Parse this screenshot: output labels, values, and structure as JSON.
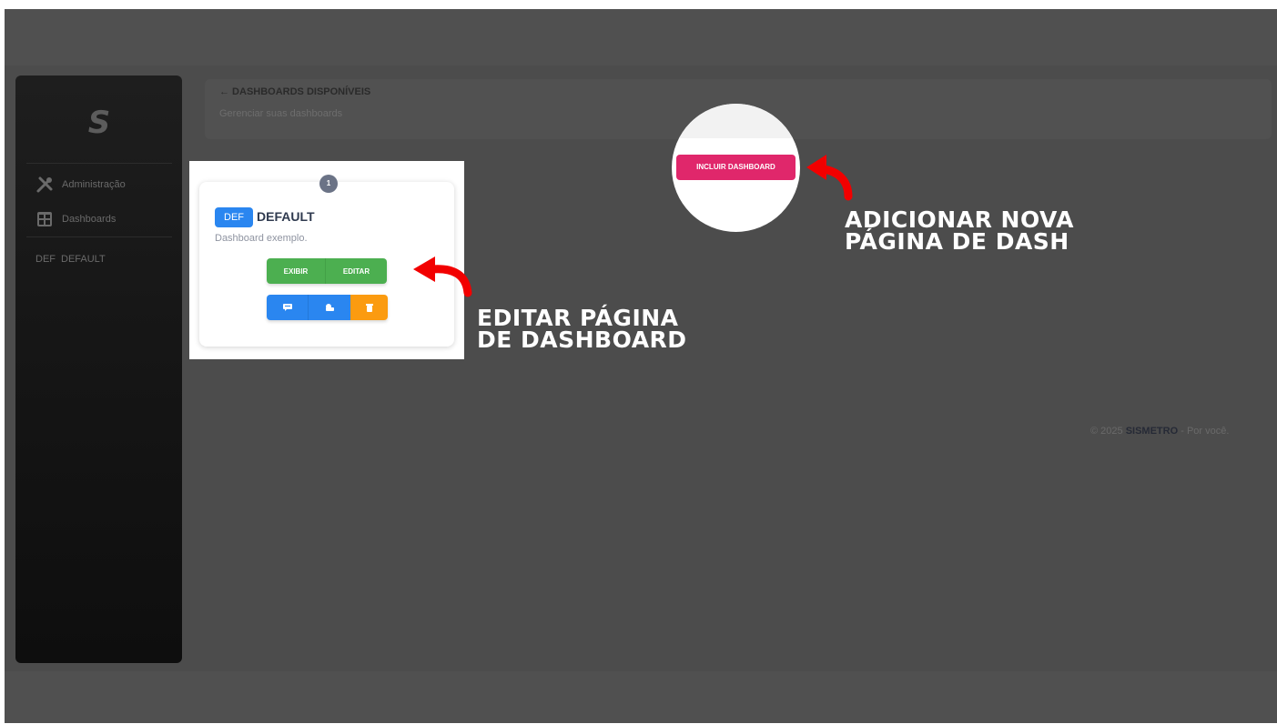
{
  "app": {
    "logo": "S"
  },
  "sidebar": {
    "items": [
      {
        "label": "Administração",
        "icon": "tools-icon"
      },
      {
        "label": "Dashboards",
        "icon": "dashboard-grid-icon"
      }
    ],
    "sub_item": {
      "prefix": "DEF",
      "label": "DEFAULT"
    }
  },
  "header": {
    "title": "← DASHBOARDS DISPONÍVEIS",
    "subtitle": "Gerenciar suas dashboards"
  },
  "dashboard_card": {
    "count": "1",
    "badge": "DEF",
    "title": "DEFAULT",
    "description": "Dashboard exemplo.",
    "view_label": "EXIBIR",
    "edit_label": "EDITAR",
    "icon_buttons": [
      {
        "icon": "comment-icon",
        "color": "#2a86f0"
      },
      {
        "icon": "share-icon",
        "color": "#2a86f0"
      },
      {
        "icon": "trash-icon",
        "color": "#fb9b10"
      }
    ]
  },
  "add_dashboard": {
    "label": "INCLUIR DASHBOARD"
  },
  "footer": {
    "year": "© 2025",
    "brand": "SISMETRO",
    "tagline": "- Por você."
  },
  "annotations": {
    "edit": [
      "EDITAR PÁGINA",
      "DE DASHBOARD"
    ],
    "add": [
      "ADICIONAR NOVA",
      "PÁGINA DE DASH"
    ]
  },
  "colors": {
    "primary_blue": "#2a86f0",
    "success_green": "#4caf50",
    "warning_orange": "#fb9b10",
    "pink": "#e0276b",
    "arrow_red": "#f20000"
  }
}
